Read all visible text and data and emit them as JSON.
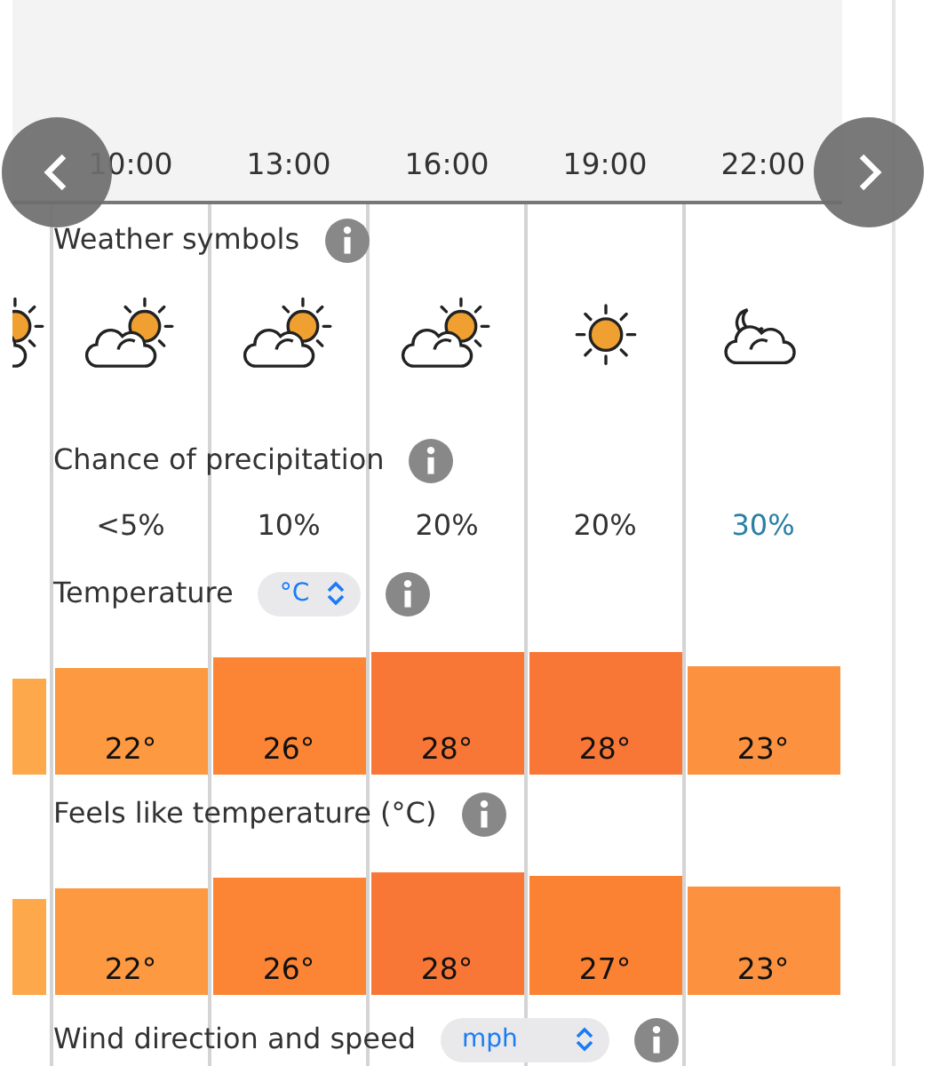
{
  "previous_column": {
    "kind": "partly-cloudy",
    "temperature": {
      "color": "#fda84a"
    },
    "feels_like": {
      "color": "#fda84a"
    }
  },
  "columns": [
    {
      "time": "10:00",
      "kind": "partly-cloudy",
      "precipitation": "<5%",
      "highlighted": false,
      "temperature": {
        "value": "22°",
        "color": "#fd9940"
      },
      "feels_like": {
        "value": "22°",
        "color": "#fd9940"
      }
    },
    {
      "time": "13:00",
      "kind": "partly-cloudy",
      "precipitation": "10%",
      "highlighted": false,
      "temperature": {
        "value": "26°",
        "color": "#fc8535"
      },
      "feels_like": {
        "value": "26°",
        "color": "#fc8535"
      }
    },
    {
      "time": "16:00",
      "kind": "partly-cloudy",
      "precipitation": "20%",
      "highlighted": false,
      "temperature": {
        "value": "28°",
        "color": "#f97736"
      },
      "feels_like": {
        "value": "28°",
        "color": "#f97736"
      }
    },
    {
      "time": "19:00",
      "kind": "sunny",
      "precipitation": "20%",
      "highlighted": false,
      "temperature": {
        "value": "28°",
        "color": "#f97736"
      },
      "feels_like": {
        "value": "27°",
        "color": "#fc8233"
      }
    },
    {
      "time": "22:00",
      "kind": "night-cloudy",
      "precipitation": "30%",
      "highlighted": true,
      "temperature": {
        "value": "23°",
        "color": "#fc9240"
      },
      "feels_like": {
        "value": "23°",
        "color": "#fc9240"
      }
    }
  ],
  "sections": [
    {
      "kind": "symbols",
      "label": "Weather symbols"
    },
    {
      "kind": "precipitation",
      "label": "Chance of precipitation"
    },
    {
      "kind": "temperature",
      "label": "Temperature",
      "unit": "°C"
    },
    {
      "kind": "feels_like",
      "label": "Feels like temperature (°C)"
    },
    {
      "kind": "wind",
      "label": "Wind direction and speed",
      "unit": "mph"
    }
  ]
}
